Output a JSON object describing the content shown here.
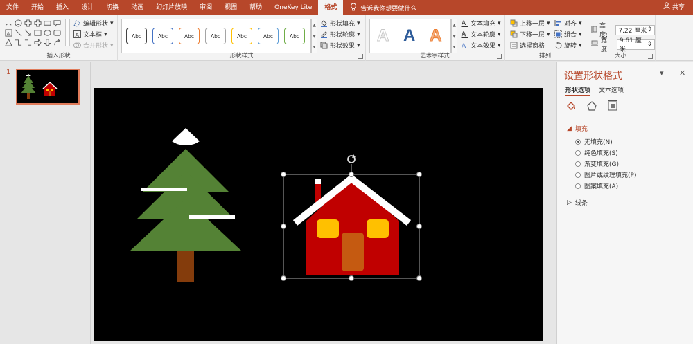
{
  "tabs": [
    "文件",
    "开始",
    "插入",
    "设计",
    "切换",
    "动画",
    "幻灯片放映",
    "审阅",
    "视图",
    "帮助",
    "OneKey Lite",
    "格式"
  ],
  "active_tab": "格式",
  "tell_me": "告诉我你想要做什么",
  "share": "共享",
  "ribbon": {
    "insert_shapes": {
      "label": "插入形状",
      "edit_shape": "编辑形状",
      "text_box": "文本框",
      "merge_shapes": "合并形状"
    },
    "shape_styles": {
      "label": "形状样式",
      "sample": "Abc",
      "style_colors": [
        "#444444",
        "#4472c4",
        "#ed7d31",
        "#a5a5a5",
        "#ffc000",
        "#5b9bd5",
        "#70ad47"
      ],
      "fill": "形状填充",
      "outline": "形状轮廓",
      "effects": "形状效果"
    },
    "wordart": {
      "label": "艺术字样式",
      "sample": "A",
      "text_fill": "文本填充",
      "text_outline": "文本轮廓",
      "text_effects": "文本效果"
    },
    "arrange": {
      "label": "排列",
      "bring_forward": "上移一层",
      "send_backward": "下移一层",
      "selection_pane": "选择窗格",
      "align": "对齐",
      "group": "组合",
      "rotate": "旋转"
    },
    "size": {
      "label": "大小",
      "height_label": "高度:",
      "height_value": "7.22 厘米",
      "width_label": "宽度:",
      "width_value": "9.61 厘米"
    }
  },
  "thumbnails": {
    "slide_number": "1"
  },
  "pane": {
    "title": "设置形状格式",
    "tab_shape": "形状选项",
    "tab_text": "文本选项",
    "fill_section": "填充",
    "fill_options": [
      "无填充(N)",
      "纯色填充(S)",
      "渐变填充(G)",
      "图片或纹理填充(P)",
      "图案填充(A)"
    ],
    "selected_fill": 0,
    "line_section": "线条"
  },
  "colors": {
    "accent": "#b7472a",
    "tree_green": "#548235",
    "trunk_brown": "#843c0c",
    "house_red": "#c00000",
    "window_yellow": "#ffc000",
    "door_orange": "#c55a11"
  }
}
